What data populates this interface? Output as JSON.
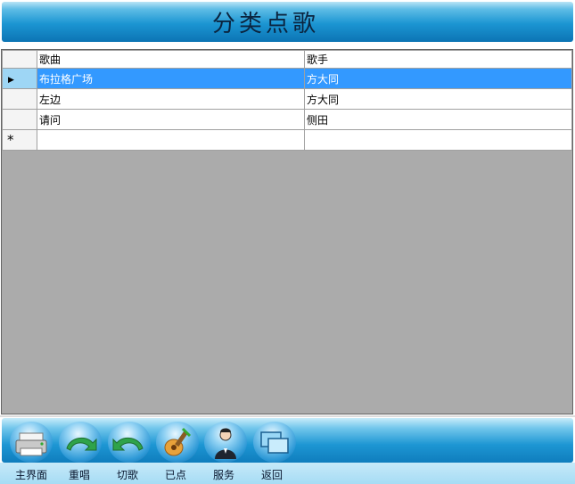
{
  "header": {
    "title": "分类点歌"
  },
  "grid": {
    "columns": [
      "歌曲",
      "歌手"
    ],
    "rows": [
      {
        "song": "布拉格广场",
        "singer": "方大同"
      },
      {
        "song": "左边",
        "singer": "方大同"
      },
      {
        "song": "请问",
        "singer": "侧田"
      }
    ],
    "new_row_marker": "*",
    "current_row_marker": "▶"
  },
  "toolbar": {
    "buttons": [
      {
        "label": "主界面",
        "icon": "printer-icon"
      },
      {
        "label": "重唱",
        "icon": "redo-arrow-icon"
      },
      {
        "label": "切歌",
        "icon": "skip-arrow-icon"
      },
      {
        "label": "已点",
        "icon": "guitar-icon"
      },
      {
        "label": "服务",
        "icon": "waiter-icon"
      },
      {
        "label": "返回",
        "icon": "windows-icon"
      }
    ]
  },
  "colors": {
    "header_blue": "#1b95d2",
    "selected_row": "#3399ff",
    "grid_background": "#ababab"
  }
}
